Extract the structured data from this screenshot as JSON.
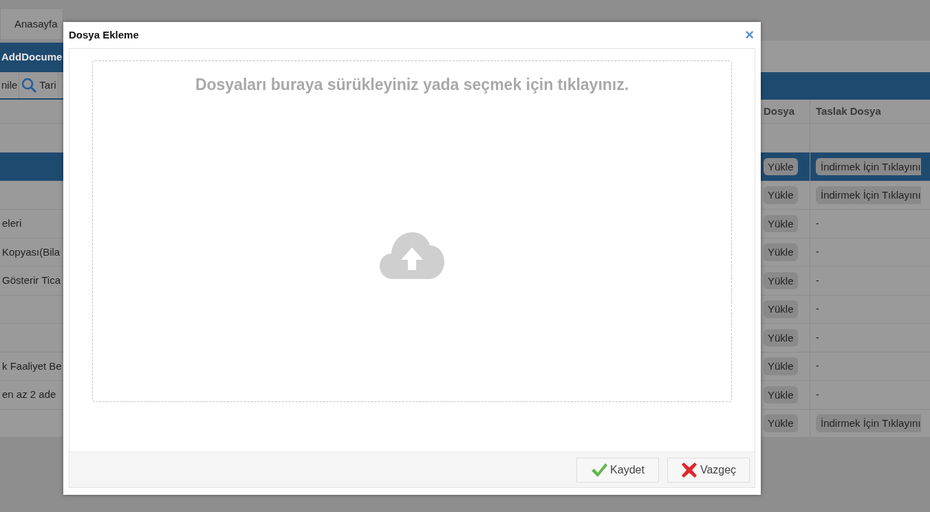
{
  "background": {
    "home_tab": {
      "label": "Anasayfa"
    },
    "panel_title": "AddDocume",
    "toolbar": [
      {
        "kind": "plain",
        "label": "nile"
      },
      {
        "kind": "search",
        "label": "Tari"
      }
    ],
    "table": {
      "columns": [
        "Dosya",
        "Taslak Dosya"
      ],
      "rows": [
        {
          "selected": true,
          "upload": "Yükle",
          "draft": {
            "kind": "button",
            "text": "İndirmek İçin Tıklayını"
          }
        },
        {
          "selected": false,
          "upload": "Yükle",
          "draft": {
            "kind": "button",
            "text": "İndirmek İçin Tıklayını"
          }
        },
        {
          "selected": false,
          "column_1": "eleri",
          "upload": "Yükle",
          "draft": {
            "kind": "text",
            "text": "-"
          }
        },
        {
          "selected": false,
          "column_1": "Kopyası(Bila",
          "upload": "Yükle",
          "draft": {
            "kind": "text",
            "text": "-"
          }
        },
        {
          "selected": false,
          "column_1": "Gösterir Tica",
          "upload": "Yükle",
          "draft": {
            "kind": "text",
            "text": "-"
          }
        },
        {
          "selected": false,
          "upload": "Yükle",
          "draft": {
            "kind": "text",
            "text": "-"
          }
        },
        {
          "selected": false,
          "upload": "Yükle",
          "draft": {
            "kind": "text",
            "text": "-"
          }
        },
        {
          "selected": false,
          "column_1": "k Faaliyet Be",
          "upload": "Yükle",
          "draft": {
            "kind": "text",
            "text": "-"
          }
        },
        {
          "selected": false,
          "column_1": "en az 2 ade",
          "upload": "Yükle",
          "draft": {
            "kind": "text",
            "text": "-"
          }
        },
        {
          "selected": false,
          "upload": "Yükle",
          "draft": {
            "kind": "button",
            "text": "İndirmek İçin Tıklayını"
          }
        }
      ]
    }
  },
  "dialog": {
    "title": "Dosya Ekleme",
    "close": "×",
    "dropzone": {
      "message": "Dosyaları buraya sürükleyiniz yada seçmek için tıklayınız."
    },
    "buttons": [
      {
        "kind": "save",
        "label": "Kaydet"
      },
      {
        "kind": "cancel",
        "label": "Vazgeç"
      }
    ]
  }
}
